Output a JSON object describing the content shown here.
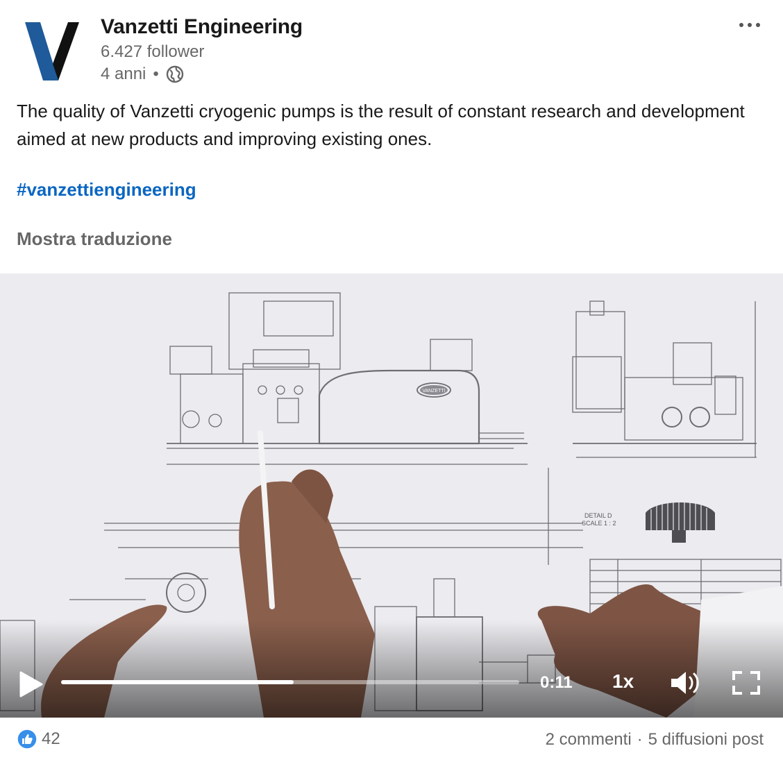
{
  "author": {
    "name": "Vanzetti Engineering",
    "followers": "6.427 follower",
    "age": "4 anni",
    "separator": "•"
  },
  "post": {
    "text": "The quality of Vanzetti cryogenic pumps is the result of constant research and development aimed at new products and improving existing ones.",
    "hashtag": "#vanzettiengineering",
    "translate_label": "Mostra traduzione"
  },
  "video": {
    "current_time": "0:11",
    "speed": "1x",
    "progress_fraction": 0.508,
    "detail_label": "DETAIL D",
    "scale_label": "SCALE 1 : 2",
    "nameplate": "VANZETTI"
  },
  "footer": {
    "reaction_count": "42",
    "comments": "2 commenti",
    "separator": "·",
    "shares": "5 diffusioni post"
  },
  "colors": {
    "brand_blue": "#1f5a9a",
    "link_blue": "#0a66c2",
    "video_bg": "#ecebef"
  },
  "icons": [
    "more-icon",
    "globe-icon",
    "play-icon",
    "volume-icon",
    "fullscreen-icon",
    "like-icon"
  ]
}
